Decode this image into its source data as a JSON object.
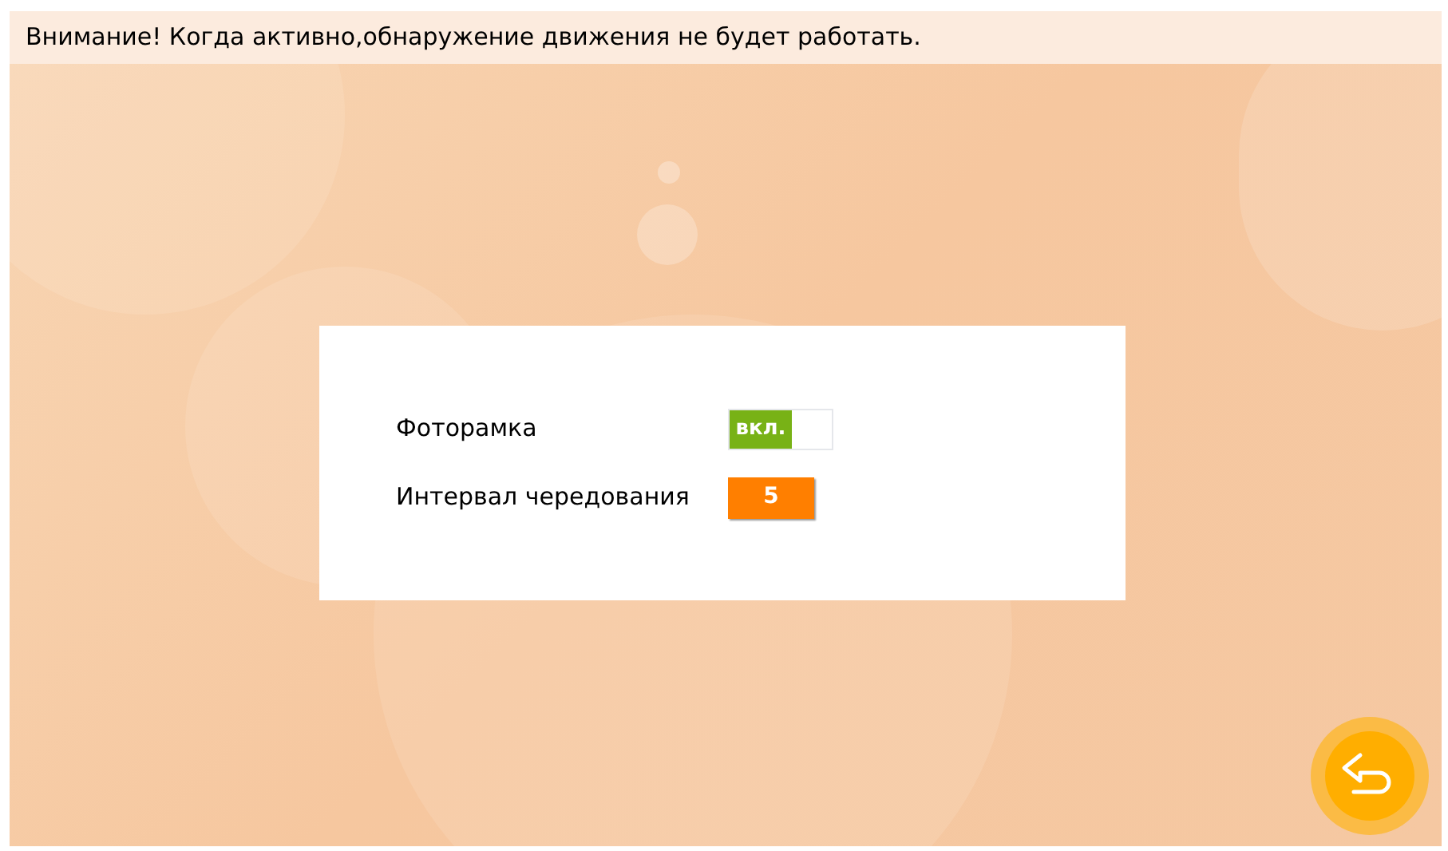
{
  "notice": "Внимание! Когда активно,обнаружение движения не будет работать.",
  "settings": [
    {
      "kind": "toggle",
      "label": "Фоторамка",
      "on": true,
      "value": "вкл."
    },
    {
      "kind": "value",
      "label": "Интервал чередования",
      "value": "5"
    }
  ]
}
